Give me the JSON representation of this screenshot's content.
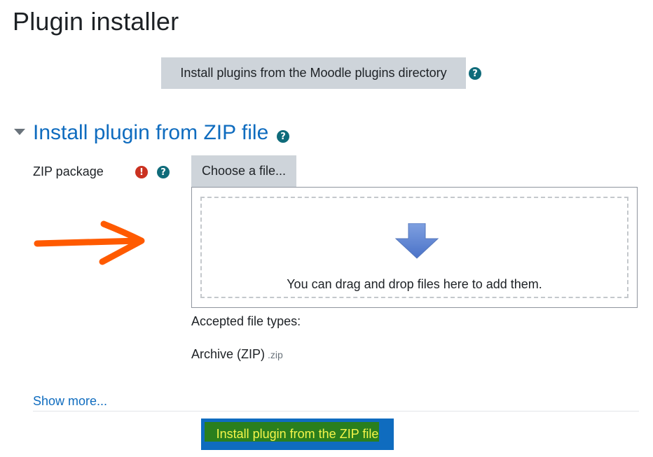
{
  "page": {
    "title": "Plugin installer"
  },
  "directory": {
    "button_label": "Install plugins from the Moodle plugins directory",
    "help_icon": "question-circle-icon"
  },
  "section": {
    "heading": "Install plugin from ZIP file",
    "help_icon": "question-circle-icon",
    "expanded": true
  },
  "zip_field": {
    "label": "ZIP package",
    "required_icon": "exclamation-circle-icon",
    "help_icon": "question-circle-icon",
    "choose_file_label": "Choose a file...",
    "dropzone_text": "You can drag and drop files here to add them.",
    "accepted_label": "Accepted file types:",
    "archive_label": "Archive (ZIP)",
    "archive_ext": ".zip"
  },
  "show_more": "Show more...",
  "submit": {
    "label": "Install plugin from the ZIP file"
  },
  "colors": {
    "link": "#0f6cbf",
    "secondary_button": "#ced4da",
    "primary_button": "#0f6cbf",
    "help_icon": "#0f6b7a",
    "required_icon": "#ca3120",
    "annotation_arrow": "#ff5a00",
    "highlight_bg": "#2a7f1d",
    "highlight_text": "#f5f54a"
  }
}
